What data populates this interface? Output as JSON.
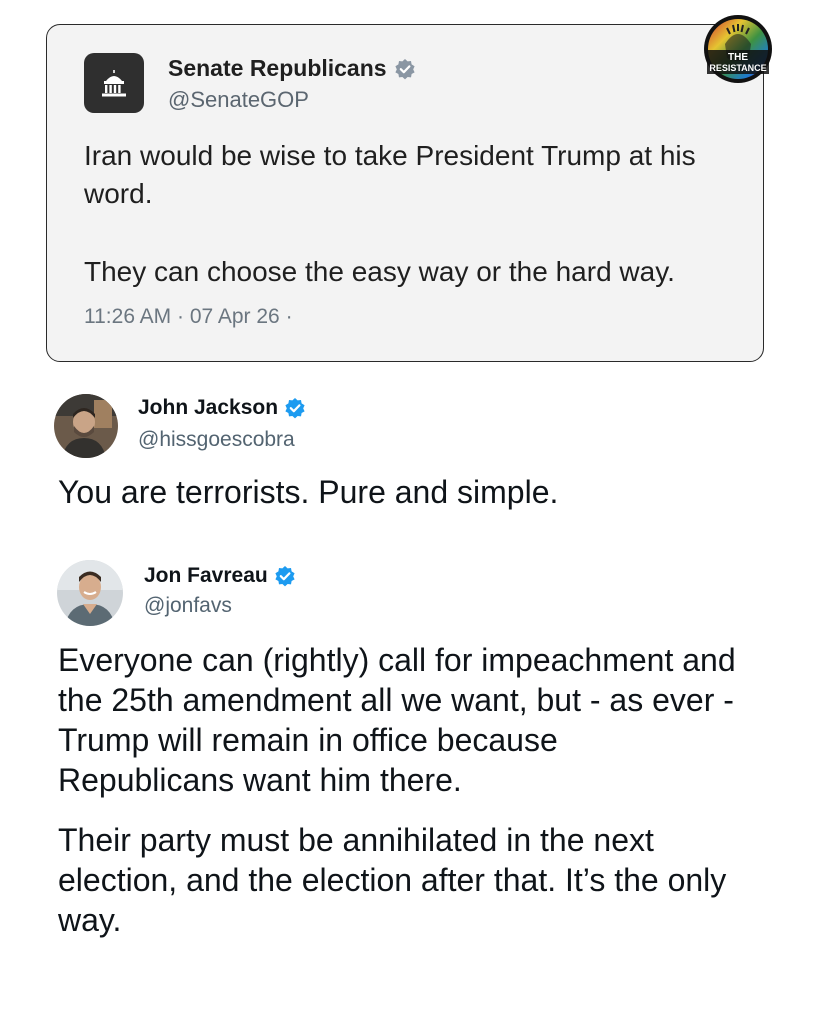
{
  "quoted_tweet": {
    "author_name": "Senate Republicans",
    "handle": "@SenateGOP",
    "verified": true,
    "avatar_icon": "capitol-building-icon",
    "paragraphs": [
      "Iran would be wise to take President Trump at his word.",
      "They can choose the easy way or the hard way."
    ],
    "timestamp": "11:26 AM · 07 Apr 26 ·"
  },
  "watermark": {
    "line1": "THE",
    "line2": "RESISTANCE"
  },
  "replies": [
    {
      "author_name": "John Jackson",
      "handle": "@hissgoescobra",
      "verified": true,
      "text": "You are terrorists. Pure and simple."
    },
    {
      "author_name": "Jon Favreau",
      "handle": "@jonfavs",
      "verified": true,
      "paragraphs": [
        "Everyone can (rightly) call for impeachment and the 25th amendment all we want, but - as ever - Trump will remain in office because Republicans want him there.",
        "Their party must be annihilated in the next election, and the election after that. It’s the only way."
      ]
    }
  ],
  "colors": {
    "verified_blue": "#1d9bf0",
    "quote_bg": "#f3f3f3",
    "handle_gray": "#536471"
  }
}
